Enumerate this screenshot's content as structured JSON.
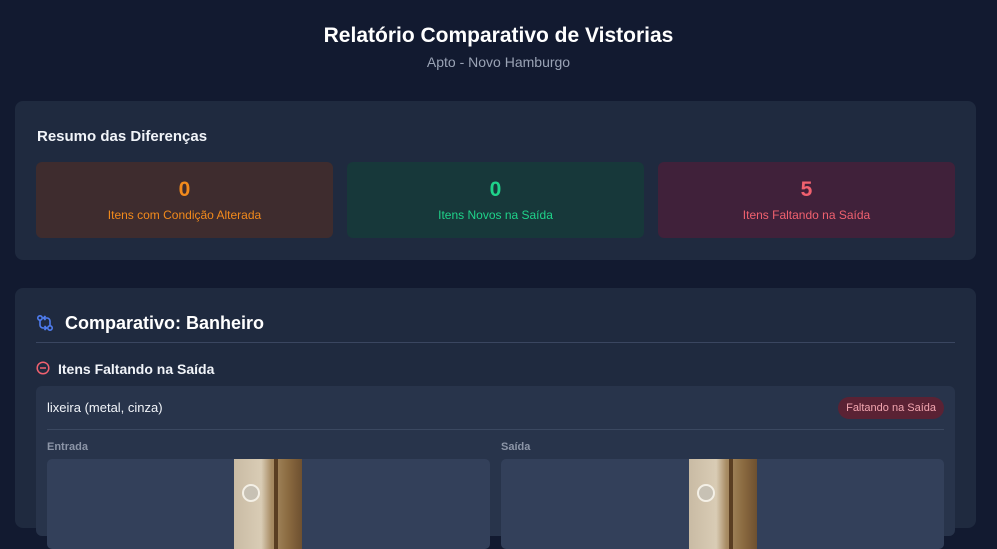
{
  "header": {
    "title": "Relatório Comparativo de Vistorias",
    "subtitle": "Apto - Novo Hamburgo"
  },
  "summary": {
    "title": "Resumo das Diferenças",
    "stats": [
      {
        "value": "0",
        "label": "Itens com Condição Alterada",
        "color": "#f28a1c"
      },
      {
        "value": "0",
        "label": "Itens Novos na Saída",
        "color": "#1fd38a"
      },
      {
        "value": "5",
        "label": "Itens Faltando na Saída",
        "color": "#f0616f"
      }
    ]
  },
  "comparison": {
    "icon": "compare-arrows-icon",
    "title": "Comparativo: Banheiro",
    "section": {
      "icon": "minus-circle-icon",
      "title": "Itens Faltando na Saída",
      "items": [
        {
          "name": "lixeira (metal, cinza)",
          "badge": "Faltando na Saída",
          "entry_label": "Entrada",
          "exit_label": "Saída"
        }
      ]
    }
  },
  "colors": {
    "background": "#121a30",
    "card": "#1f2a3f",
    "accent_blue": "#4f7df0",
    "missing_red": "#f0616f"
  }
}
